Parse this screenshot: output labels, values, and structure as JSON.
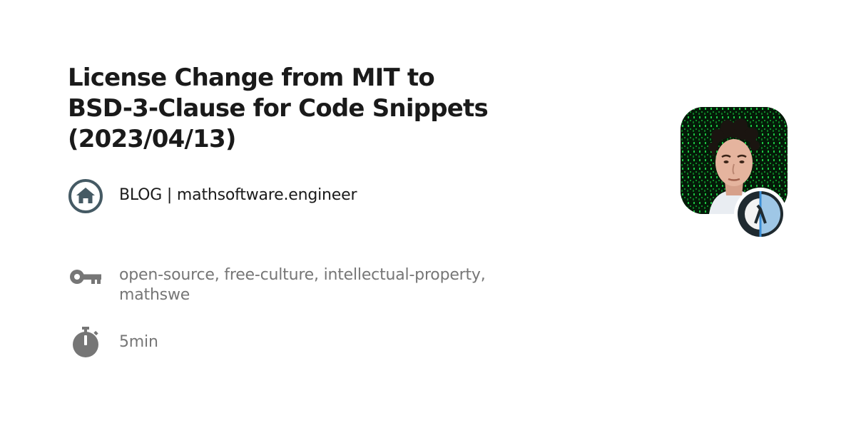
{
  "post": {
    "title_line1": "License Change from MIT to",
    "title_line2": "BSD-3-Clause for Code Snippets",
    "title_line3": "(2023/04/13)"
  },
  "site": {
    "label": "BLOG | mathsoftware.engineer",
    "icon": "home-icon"
  },
  "tags": {
    "label": "open-source, free-culture, intellectual-property, mathswe",
    "icon": "key-icon"
  },
  "reading_time": {
    "label": "5min",
    "icon": "stopwatch-icon"
  },
  "author": {
    "avatar": "author-avatar",
    "badge": "lambda-logo"
  },
  "colors": {
    "title": "#1a1a1a",
    "muted": "#767676",
    "home_icon": "#455a64",
    "badge_dark": "#1f2a30",
    "badge_blue": "#3d8fd6",
    "badge_light": "#9fc7e6",
    "matrix_green": "#1fe04a"
  }
}
